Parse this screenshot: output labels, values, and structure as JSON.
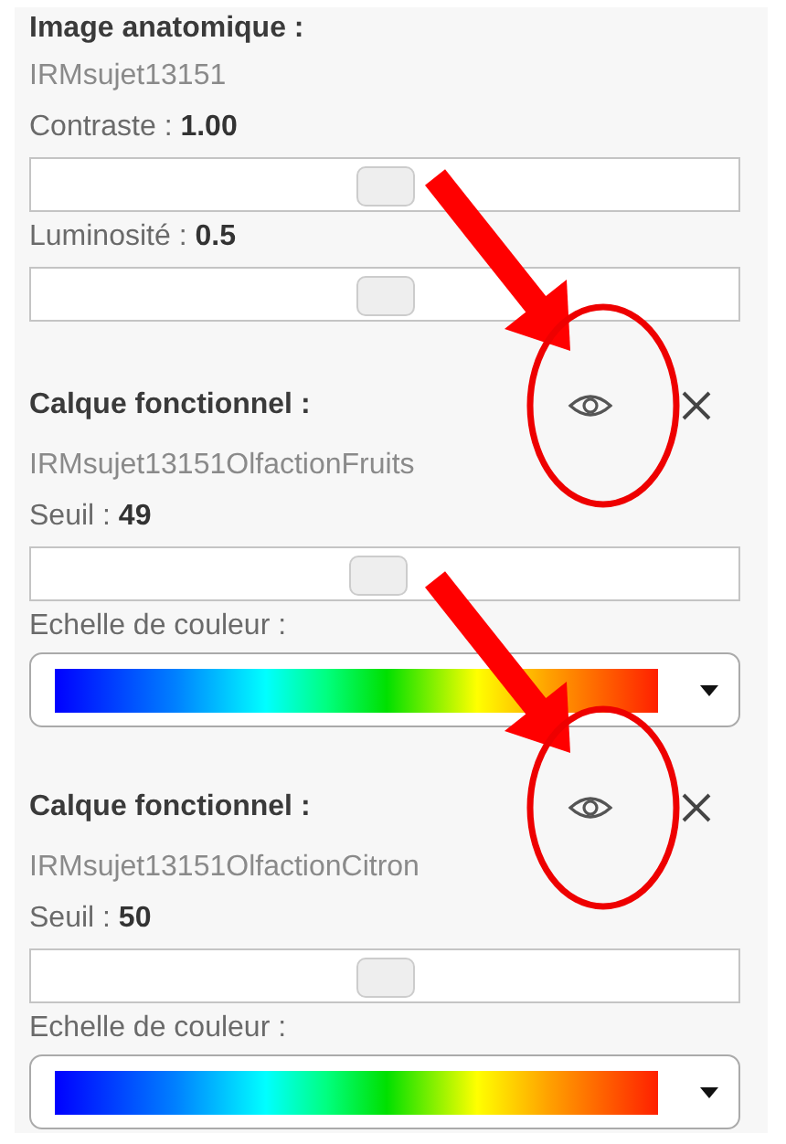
{
  "anatomical": {
    "heading": "Image anatomique :",
    "name": "IRMsujet13151",
    "controls": [
      {
        "label": "Contraste : **1.00**",
        "level": 0.5
      },
      {
        "label": "Luminosité : **0.5**",
        "level": 0.5
      }
    ]
  },
  "layers": [
    {
      "heading": "Calque fonctionnel :",
      "visible": true,
      "highlighted": true,
      "name": "IRMsujet13151OlfactionFruits",
      "threshold": {
        "label": "Seuil : **49**",
        "level": 0.49
      },
      "colorscale": {
        "label": "Echelle de couleur :"
      }
    },
    {
      "heading": "Calque fonctionnel :",
      "visible": true,
      "highlighted": true,
      "name": "IRMsujet13151OlfactionCitron",
      "threshold": {
        "label": "Seuil : **50**",
        "level": 0.5
      },
      "colorscale": {
        "label": "Echelle de couleur :"
      }
    }
  ]
}
